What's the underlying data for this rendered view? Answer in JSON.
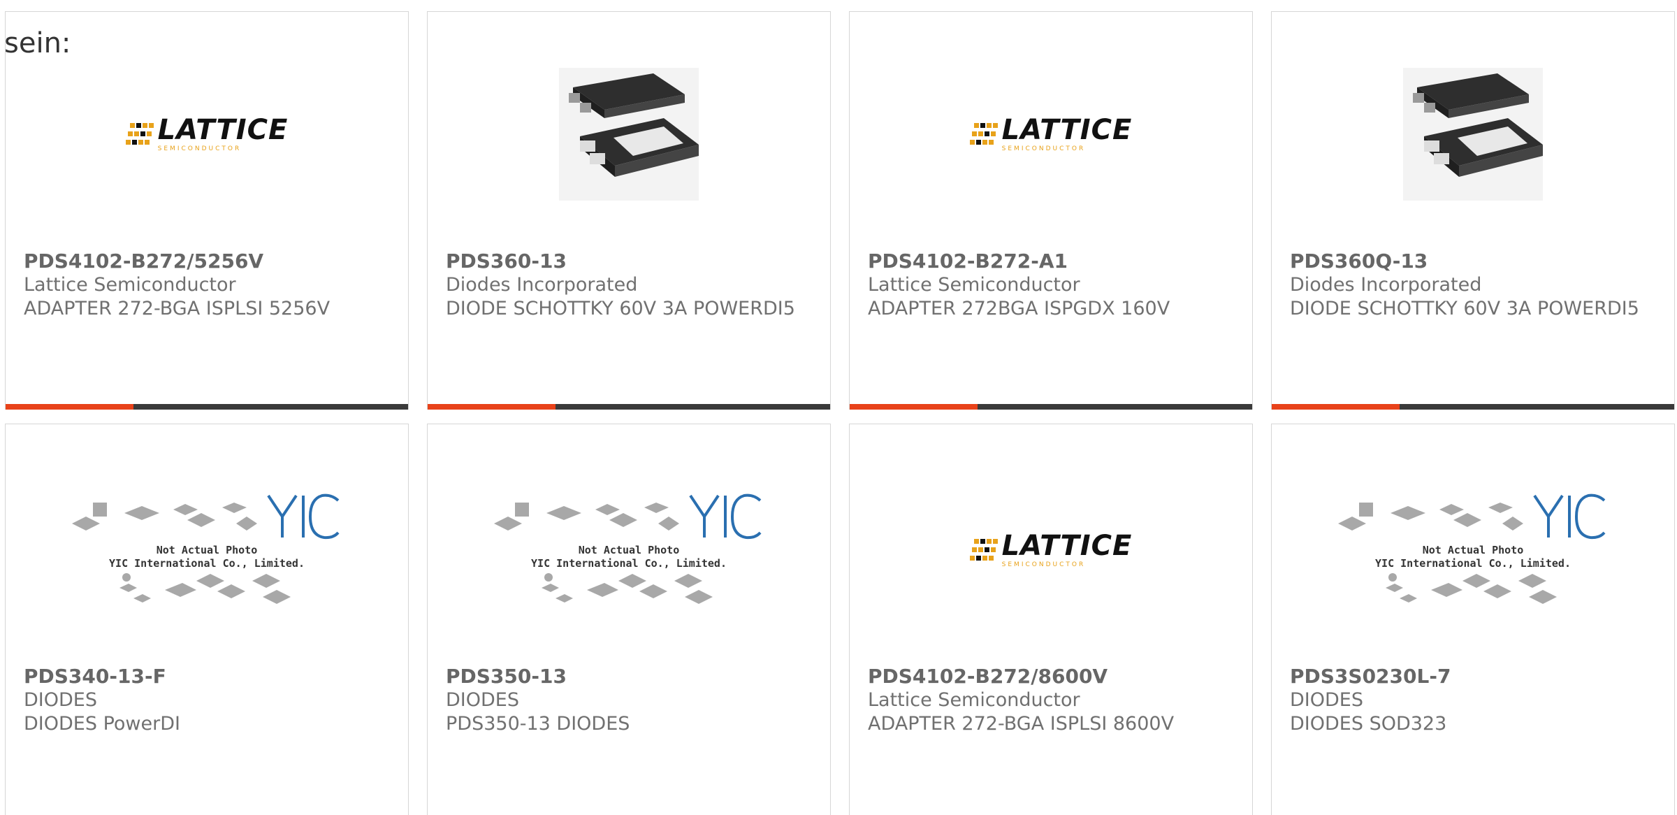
{
  "heading": "sein:",
  "brand_accent": "#e8421a",
  "cards": [
    {
      "part": "PDS4102-B272/5256V",
      "maker": "Lattice Semiconductor",
      "desc": "ADAPTER 272-BGA ISPLSI 5256V",
      "image": "lattice-logo"
    },
    {
      "part": "PDS360-13",
      "maker": "Diodes Incorporated",
      "desc": "DIODE SCHOTTKY 60V 3A POWERDI5",
      "image": "powerdi5-package"
    },
    {
      "part": "PDS4102-B272-A1",
      "maker": "Lattice Semiconductor",
      "desc": "ADAPTER 272BGA ISPGDX 160V",
      "image": "lattice-logo"
    },
    {
      "part": "PDS360Q-13",
      "maker": "Diodes Incorporated",
      "desc": "DIODE SCHOTTKY 60V 3A POWERDI5",
      "image": "powerdi5-package"
    },
    {
      "part": "PDS340-13-F",
      "maker": "DIODES",
      "desc": "DIODES PowerDI",
      "image": "yic-placeholder"
    },
    {
      "part": "PDS350-13",
      "maker": "DIODES",
      "desc": "PDS350-13 DIODES",
      "image": "yic-placeholder"
    },
    {
      "part": "PDS4102-B272/8600V",
      "maker": "Lattice Semiconductor",
      "desc": "ADAPTER 272-BGA ISPLSI 8600V",
      "image": "lattice-logo"
    },
    {
      "part": "PDS3S0230L-7",
      "maker": "DIODES",
      "desc": "DIODES SOD323",
      "image": "yic-placeholder"
    }
  ],
  "logo": {
    "lattice_word": "LATTICE",
    "lattice_sub": "SEMICONDUCTOR"
  },
  "yic": {
    "mark": "YIC",
    "caption_1": "Not Actual Photo",
    "caption_2": "YIC International Co., Limited."
  }
}
